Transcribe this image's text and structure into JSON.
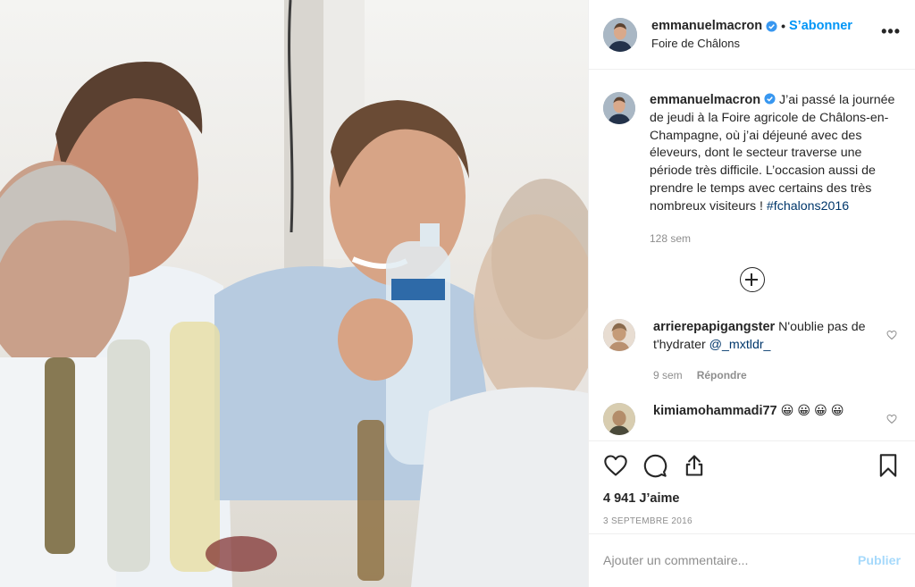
{
  "post": {
    "author": "emmanuelmacron",
    "follow_label": "S’abonner",
    "separator": "•",
    "location": "Foire de Châlons",
    "more_label": "•••"
  },
  "caption": {
    "username": "emmanuelmacron",
    "text": " J’ai passé la journée de jeudi à la Foire agricole de Châlons-en-Champagne, où j’ai déjeuné avec des éleveurs, dont le secteur traverse une période très difficile. L’occasion aussi de prendre le temps avec certains des très nombreux visiteurs ! ",
    "hashtag": "#fchalons2016",
    "age": "128 sem"
  },
  "comments": [
    {
      "username": "arrierepapigangster",
      "text": " N'oublie pas de t'hydrater ",
      "mention": "@_mxtldr_",
      "age": "9 sem",
      "reply_label": "Répondre"
    },
    {
      "username": "kimiamohammadi77",
      "text": " 😀 😀 😀 😀",
      "mention": "",
      "age": "",
      "reply_label": ""
    }
  ],
  "likes": "4 941 J’aime",
  "date": "3 septembre 2016",
  "add_comment": {
    "placeholder": "Ajouter un commentaire...",
    "publish_label": "Publier"
  },
  "icons": {
    "like": "heart-icon",
    "comment": "comment-bubble-icon",
    "share": "share-icon",
    "save": "bookmark-icon",
    "verified": "verified-badge-icon",
    "add": "plus-circle-icon"
  },
  "colors": {
    "accent": "#0095f6",
    "link": "#00376b",
    "muted": "#8e8e8e",
    "text": "#262626",
    "border": "#efefef"
  }
}
